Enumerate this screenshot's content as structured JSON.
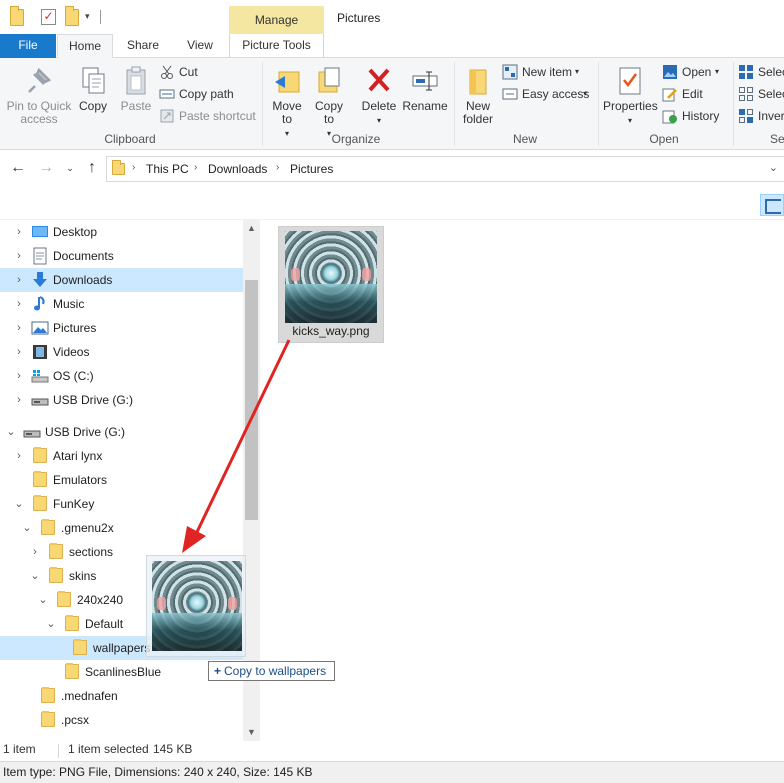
{
  "titlebar": {
    "contextual_tab": "Manage",
    "window_title": "Pictures"
  },
  "ribbon_tabs": {
    "file": "File",
    "home": "Home",
    "share": "Share",
    "view": "View",
    "picture_tools": "Picture Tools"
  },
  "ribbon": {
    "clipboard": {
      "label": "Clipboard",
      "pin": "Pin to Quick access",
      "copy": "Copy",
      "paste": "Paste",
      "cut": "Cut",
      "copy_path": "Copy path",
      "paste_shortcut": "Paste shortcut"
    },
    "organize": {
      "label": "Organize",
      "move_to": "Move to",
      "copy_to": "Copy to",
      "delete": "Delete",
      "rename": "Rename"
    },
    "new": {
      "label": "New",
      "new_folder": "New folder",
      "new_item": "New item",
      "easy_access": "Easy access"
    },
    "open": {
      "label": "Open",
      "properties": "Properties",
      "open": "Open",
      "edit": "Edit",
      "history": "History"
    },
    "select": {
      "label": "Se",
      "select_all": "Selec",
      "select_none": "Selec",
      "invert": "Inver"
    }
  },
  "address": {
    "crumbs": [
      "This PC",
      "Downloads",
      "Pictures"
    ]
  },
  "tree": {
    "items": [
      {
        "label": "Desktop"
      },
      {
        "label": "Documents"
      },
      {
        "label": "Downloads"
      },
      {
        "label": "Music"
      },
      {
        "label": "Pictures"
      },
      {
        "label": "Videos"
      },
      {
        "label": "OS (C:)"
      },
      {
        "label": "USB Drive (G:)"
      },
      {
        "label": "USB Drive (G:)"
      },
      {
        "label": "Atari lynx"
      },
      {
        "label": "Emulators"
      },
      {
        "label": "FunKey"
      },
      {
        "label": ".gmenu2x"
      },
      {
        "label": "sections"
      },
      {
        "label": "skins"
      },
      {
        "label": "240x240"
      },
      {
        "label": "Default"
      },
      {
        "label": "wallpapers"
      },
      {
        "label": "ScanlinesBlue"
      },
      {
        "label": ".mednafen"
      },
      {
        "label": ".pcsx"
      }
    ]
  },
  "content": {
    "file_name": "kicks_way.png"
  },
  "drag": {
    "tooltip": "Copy to wallpapers",
    "plus": "+"
  },
  "status": {
    "item_count": "1 item",
    "selected": "1 item selected",
    "size": "145 KB"
  },
  "details": {
    "text": "Item type: PNG File, Dimensions: 240 x 240, Size: 145 KB"
  },
  "colors": {
    "accent": "#1979ca",
    "selection": "#cce8ff",
    "drag_arrow": "#e02424",
    "manage_tab": "#f3e7a2"
  }
}
